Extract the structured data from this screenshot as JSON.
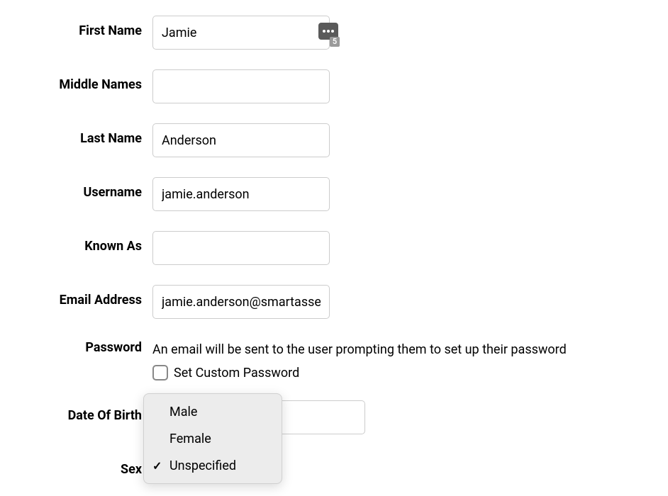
{
  "fields": {
    "first_name": {
      "label": "First Name",
      "value": "Jamie",
      "autofill_count": "5"
    },
    "middle_names": {
      "label": "Middle Names",
      "value": ""
    },
    "last_name": {
      "label": "Last Name",
      "value": "Anderson"
    },
    "username": {
      "label": "Username",
      "value": "jamie.anderson"
    },
    "known_as": {
      "label": "Known As",
      "value": ""
    },
    "email": {
      "label": "Email Address",
      "value": "jamie.anderson@smartassess.com"
    },
    "password": {
      "label": "Password",
      "note": "An email will be sent to the user prompting them to set up their password",
      "checkbox_label": "Set Custom Password"
    },
    "dob": {
      "label": "Date Of Birth",
      "value": ""
    },
    "sex": {
      "label": "Sex"
    }
  },
  "dropdown": {
    "options": [
      "Male",
      "Female",
      "Unspecified"
    ],
    "selected": "Unspecified"
  }
}
